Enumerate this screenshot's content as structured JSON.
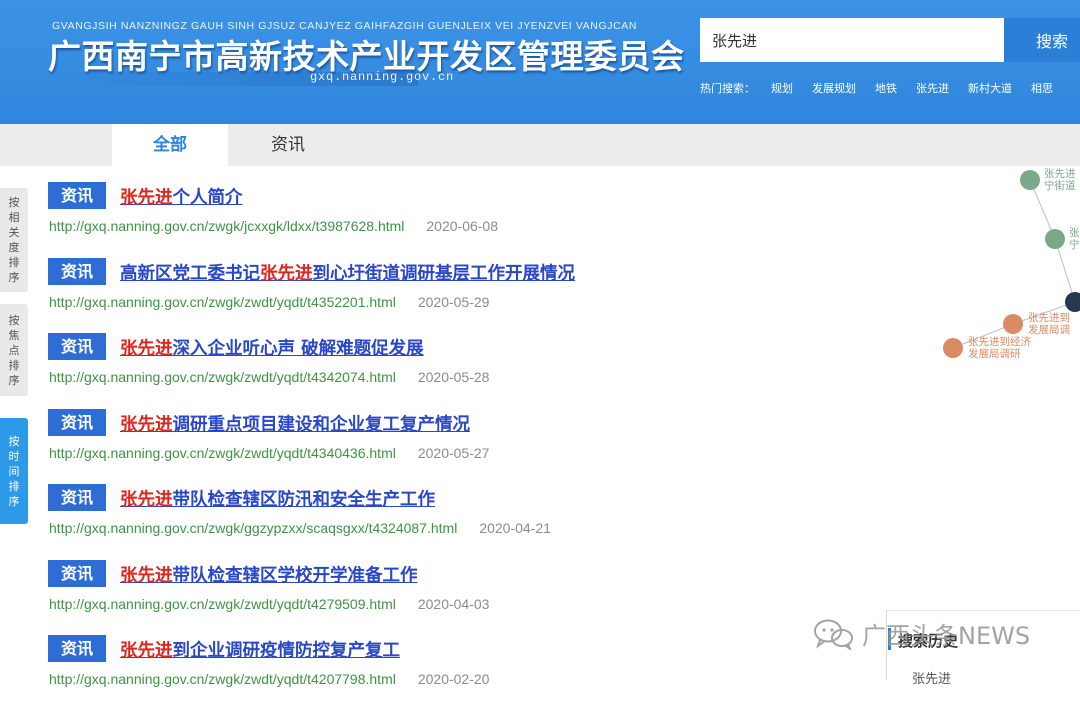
{
  "header": {
    "pinyin": "GVANGJSIH NANZNINGZ GAUH SINH GJSUZ CANJYEZ GAIHFAZGIH GUENJLEIX VEI JYENZVEI VANGJCAN",
    "title": "广西南宁市高新技术产业开发区管理委员会",
    "domain": "gxq.nanning.gov.cn",
    "search_value": "张先进",
    "search_button": "搜索",
    "hot_label": "热门搜索：",
    "hot_keywords": [
      "规划",
      "发展规划",
      "地铁",
      "张先进",
      "新村大道",
      "相思"
    ]
  },
  "tabs": [
    {
      "label": "全部",
      "active": true
    },
    {
      "label": "资讯",
      "active": false
    }
  ],
  "sort": {
    "relevance": "按相关度排序",
    "hotspot": "按焦点排序",
    "time": "按时间排序"
  },
  "results": [
    {
      "badge": "资讯",
      "hl_pre": "",
      "hl": "张先进",
      "rest": "个人简介",
      "url": "http://gxq.nanning.gov.cn/zwgk/jcxxgk/ldxx/t3987628.html",
      "date": "2020-06-08"
    },
    {
      "badge": "资讯",
      "hl_pre": "高新区党工委书记",
      "hl": "张先进",
      "rest": "到心圩街道调研基层工作开展情况",
      "url": "http://gxq.nanning.gov.cn/zwgk/zwdt/yqdt/t4352201.html",
      "date": "2020-05-29"
    },
    {
      "badge": "资讯",
      "hl_pre": "",
      "hl": "张先进",
      "rest": "深入企业听心声 破解难题促发展",
      "url": "http://gxq.nanning.gov.cn/zwgk/zwdt/yqdt/t4342074.html",
      "date": "2020-05-28"
    },
    {
      "badge": "资讯",
      "hl_pre": "",
      "hl": "张先进",
      "rest": "调研重点项目建设和企业复工复产情况",
      "url": "http://gxq.nanning.gov.cn/zwgk/zwdt/yqdt/t4340436.html",
      "date": "2020-05-27"
    },
    {
      "badge": "资讯",
      "hl_pre": "",
      "hl": "张先进",
      "rest": "带队检查辖区防汛和安全生产工作",
      "url": "http://gxq.nanning.gov.cn/zwgk/ggzypzxx/scaqsgxx/t4324087.html",
      "date": "2020-04-21"
    },
    {
      "badge": "资讯",
      "hl_pre": "",
      "hl": "张先进",
      "rest": "带队检查辖区学校开学准备工作",
      "url": "http://gxq.nanning.gov.cn/zwgk/zwdt/yqdt/t4279509.html",
      "date": "2020-04-03"
    },
    {
      "badge": "资讯",
      "hl_pre": "",
      "hl": "张先进",
      "rest": "到企业调研疫情防控复产复工",
      "url": "http://gxq.nanning.gov.cn/zwgk/zwdt/yqdt/t4207798.html",
      "date": "2020-02-20"
    }
  ],
  "graph": {
    "labels": [
      "张先进",
      "宁街道",
      "张",
      "宁",
      "张先进到",
      "发展局调",
      "张先进到经济",
      "发展局调研"
    ],
    "colors": {
      "green": "#7aa98a",
      "orange": "#dc8a63",
      "dark": "#27374d",
      "line": "#b9c2cc"
    }
  },
  "history": {
    "title": "搜索历史",
    "item": "张先进"
  },
  "watermark": {
    "text": "广西头条NEWS"
  }
}
